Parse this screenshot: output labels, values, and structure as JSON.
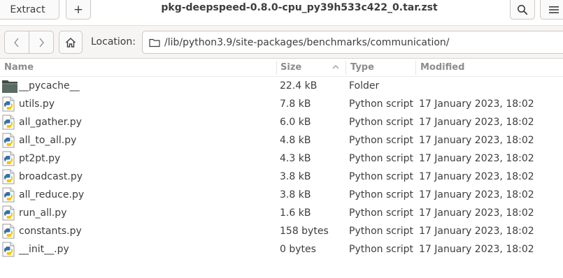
{
  "header": {
    "extract_label": "Extract",
    "add_label": "+",
    "title": "pkg-deepspeed-0.8.0-cpu_py39h533c422_0.tar.zst"
  },
  "location": {
    "label": "Location:",
    "path": "/lib/python3.9/site-packages/benchmarks/communication/"
  },
  "columns": {
    "name": "Name",
    "size": "Size",
    "type": "Type",
    "modified": "Modified"
  },
  "files": [
    {
      "name": "__pycache__",
      "size": "22.4 kB",
      "type": "Folder",
      "modified": "",
      "icon": "folder-icon"
    },
    {
      "name": "utils.py",
      "size": "7.8 kB",
      "type": "Python script",
      "modified": "17 January 2023, 18:02",
      "icon": "python-file-icon"
    },
    {
      "name": "all_gather.py",
      "size": "6.0 kB",
      "type": "Python script",
      "modified": "17 January 2023, 18:02",
      "icon": "python-file-icon"
    },
    {
      "name": "all_to_all.py",
      "size": "4.8 kB",
      "type": "Python script",
      "modified": "17 January 2023, 18:02",
      "icon": "python-file-icon"
    },
    {
      "name": "pt2pt.py",
      "size": "4.3 kB",
      "type": "Python script",
      "modified": "17 January 2023, 18:02",
      "icon": "python-file-icon"
    },
    {
      "name": "broadcast.py",
      "size": "3.8 kB",
      "type": "Python script",
      "modified": "17 January 2023, 18:02",
      "icon": "python-file-icon"
    },
    {
      "name": "all_reduce.py",
      "size": "3.8 kB",
      "type": "Python script",
      "modified": "17 January 2023, 18:02",
      "icon": "python-file-icon"
    },
    {
      "name": "run_all.py",
      "size": "1.6 kB",
      "type": "Python script",
      "modified": "17 January 2023, 18:02",
      "icon": "python-file-icon"
    },
    {
      "name": "constants.py",
      "size": "158 bytes",
      "type": "Python script",
      "modified": "17 January 2023, 18:02",
      "icon": "python-file-icon"
    },
    {
      "name": "__init__.py",
      "size": "0 bytes",
      "type": "Python script",
      "modified": "17 January 2023, 18:02",
      "icon": "python-file-icon"
    }
  ]
}
